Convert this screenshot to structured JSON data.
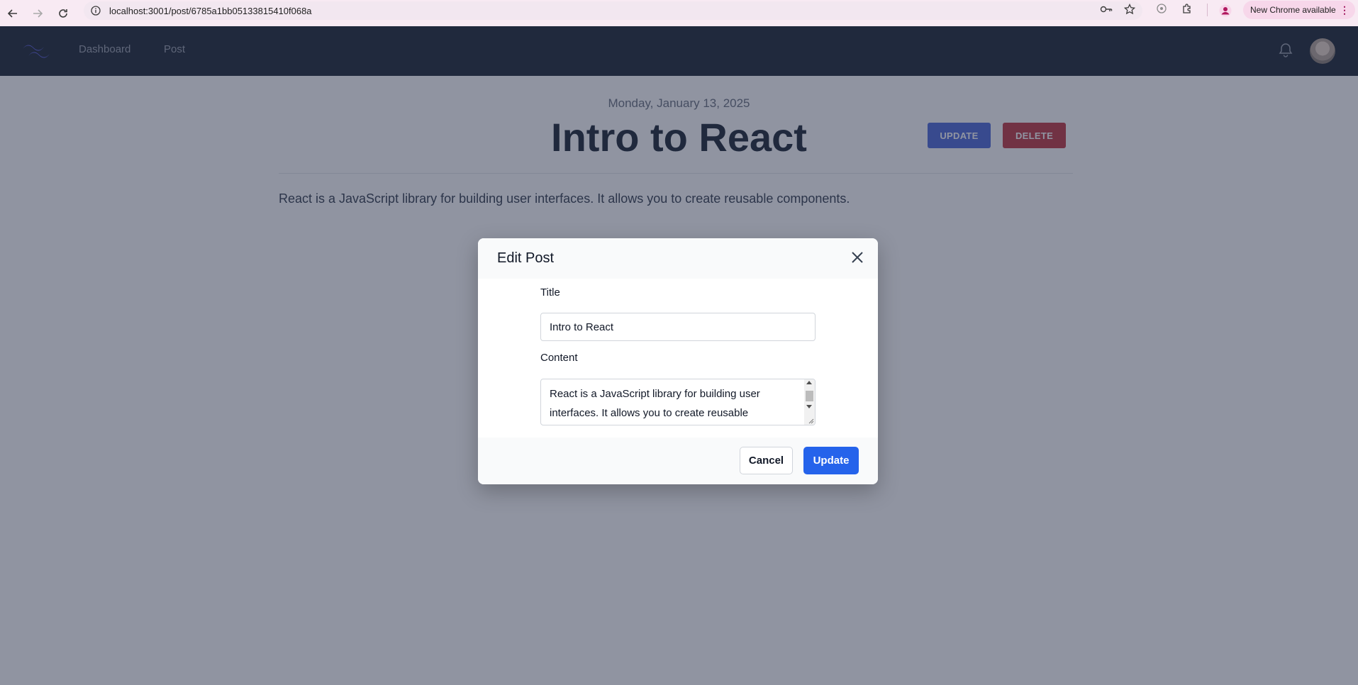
{
  "browser": {
    "url": "localhost:3001/post/6785a1bb05133815410f068a",
    "update_pill": "New Chrome available",
    "icons": [
      "back-arrow-icon",
      "forward-arrow-icon",
      "reload-icon",
      "site-info-icon",
      "password-key-icon",
      "bookmark-star-icon",
      "extension-icon",
      "puzzle-icon",
      "profile-icon",
      "more-menu-icon"
    ]
  },
  "navbar": {
    "links": [
      "Dashboard",
      "Post"
    ],
    "icons": [
      "logo-wave-icon",
      "bell-icon",
      "avatar"
    ]
  },
  "post": {
    "date": "Monday, January 13, 2025",
    "title": "Intro to React",
    "update_label": "UPDATE",
    "delete_label": "DELETE",
    "body": "React is a JavaScript library for building user interfaces. It allows you to create reusable components."
  },
  "modal": {
    "title": "Edit Post",
    "title_label": "Title",
    "title_value": "Intro to React",
    "content_label": "Content",
    "content_value": "React is a JavaScript library for building user interfaces. It allows you to create reusable",
    "cancel_label": "Cancel",
    "update_label": "Update"
  },
  "colors": {
    "navbar": "#1f2937",
    "update": "#2563eb",
    "delete": "#c03a45"
  }
}
